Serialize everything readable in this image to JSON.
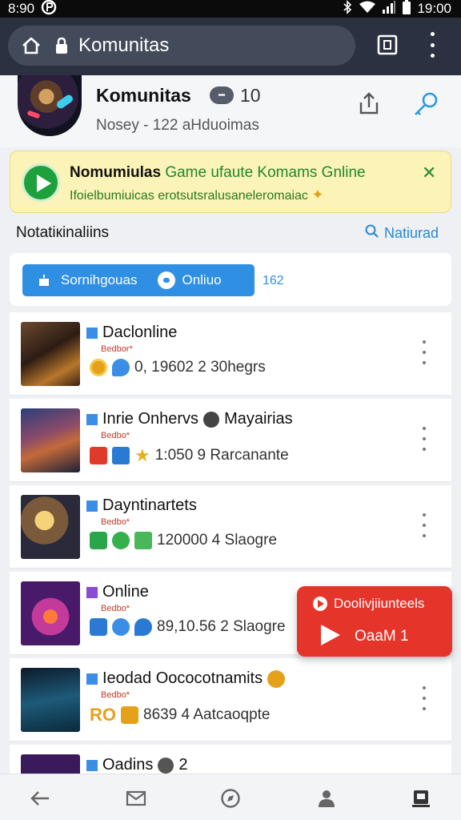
{
  "status_bar": {
    "time_left": "8:90",
    "time_right": "19:00"
  },
  "browser": {
    "url_text": "Komunitas"
  },
  "header": {
    "title": "Komunitas",
    "count": "10",
    "subtitle": "Nosey - 122 aHduoimas"
  },
  "banner": {
    "title_bold": "Nomumiulas",
    "title_rest": "Game ufaute Komams Gnline",
    "subtitle": "Ifoielbumiuicas erotsutsralusaneleromaiac"
  },
  "section": {
    "title": "Notatiкinaliins",
    "link": "Natiurad"
  },
  "filter": {
    "left_label": "Sornihgouas",
    "right_label": "Onliuo",
    "count": "162"
  },
  "rows": [
    {
      "title": "Daclonline",
      "tag": "Bedbor*",
      "stats": "0, 19602  2  30hegrs"
    },
    {
      "title": "Inrie Onhervs",
      "title_extra": "Mayairias",
      "tag": "Bedbo*",
      "stats": "1:050  9  Rarcanante"
    },
    {
      "title": "Dayntinartets",
      "tag": "Bedbo*",
      "stats": "120000  4  Slaogre"
    },
    {
      "title": "Online",
      "tag": "Bedbo*",
      "stats": "89,10.56  2  Slaogre"
    },
    {
      "title": "Ieodad Oococotnamits",
      "tag": "Bedbo*",
      "stats": "8639  4  Aatcaoqpte"
    },
    {
      "title": "Oadins",
      "title_extra": "2"
    }
  ],
  "floating_card": {
    "top_label": "Doolivjiiunteels",
    "bottom_label": "OaaM 1"
  },
  "colors": {
    "accent_blue": "#2f8fe3",
    "banner_bg": "#fbf3b7",
    "float_red": "#e5342a",
    "browser_bar": "#2b3140"
  }
}
